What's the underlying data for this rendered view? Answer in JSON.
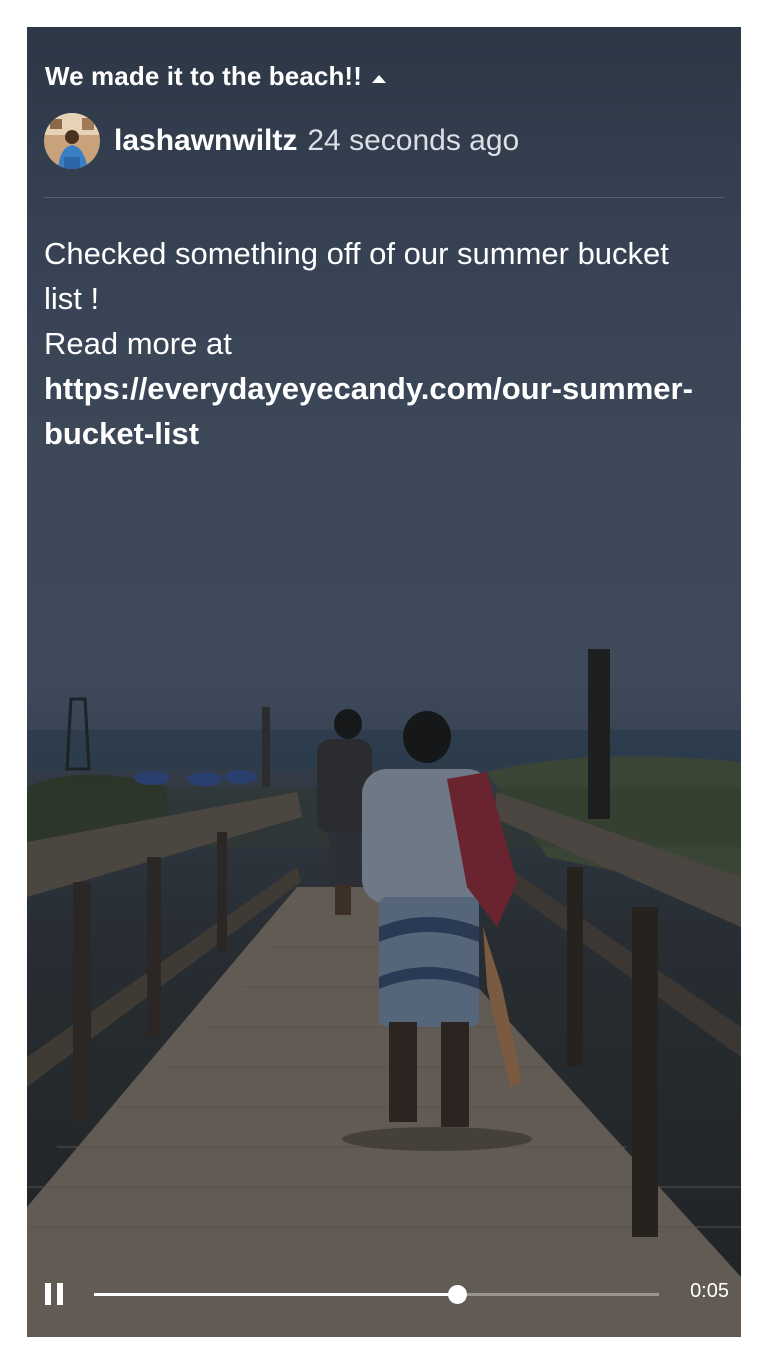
{
  "post": {
    "title": "We made it to the beach!!",
    "author": "lashawnwiltz",
    "timestamp": "24 seconds ago",
    "caption_line1": "Checked something off of our summer bucket list !",
    "caption_prefix": "Read more at ",
    "caption_link": "https://everydayeyecandy.com/our-summer-bucket-list"
  },
  "player": {
    "state": "playing",
    "elapsed": "0:05",
    "progress": 0.643
  },
  "icons": {
    "collapse": "caret-up-icon",
    "pause": "pause-icon"
  }
}
